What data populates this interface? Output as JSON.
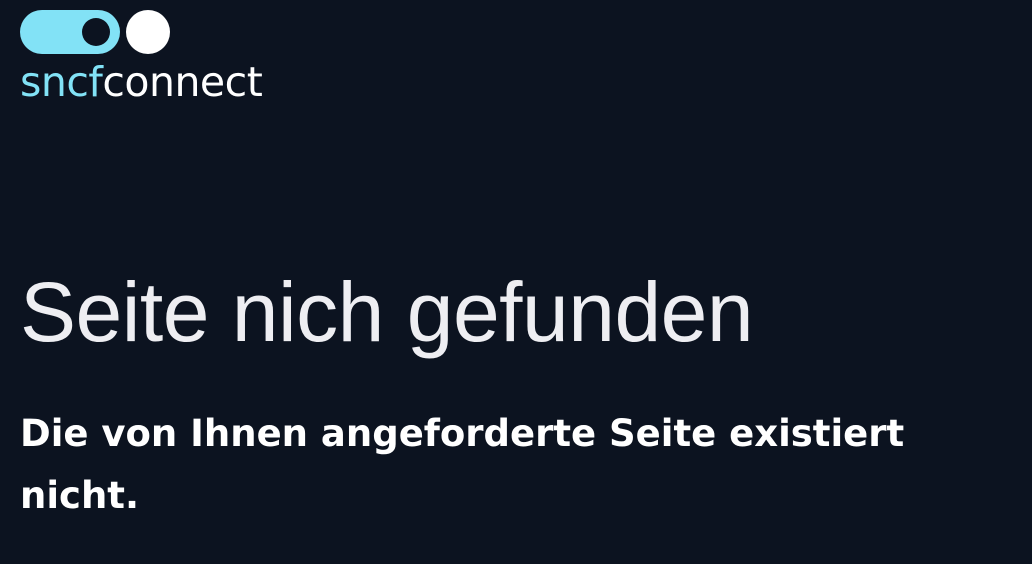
{
  "header": {
    "logo": {
      "text_part_a": "sncf",
      "text_part_b": "connect",
      "icon": "toggle-logo-icon"
    }
  },
  "main": {
    "title": "Seite nich gefunden",
    "message": "Die von Ihnen angeforderte Seite existiert nicht."
  },
  "colors": {
    "background": "#0c1320",
    "brand_accent": "#82e2f6",
    "text": "#ffffff"
  }
}
